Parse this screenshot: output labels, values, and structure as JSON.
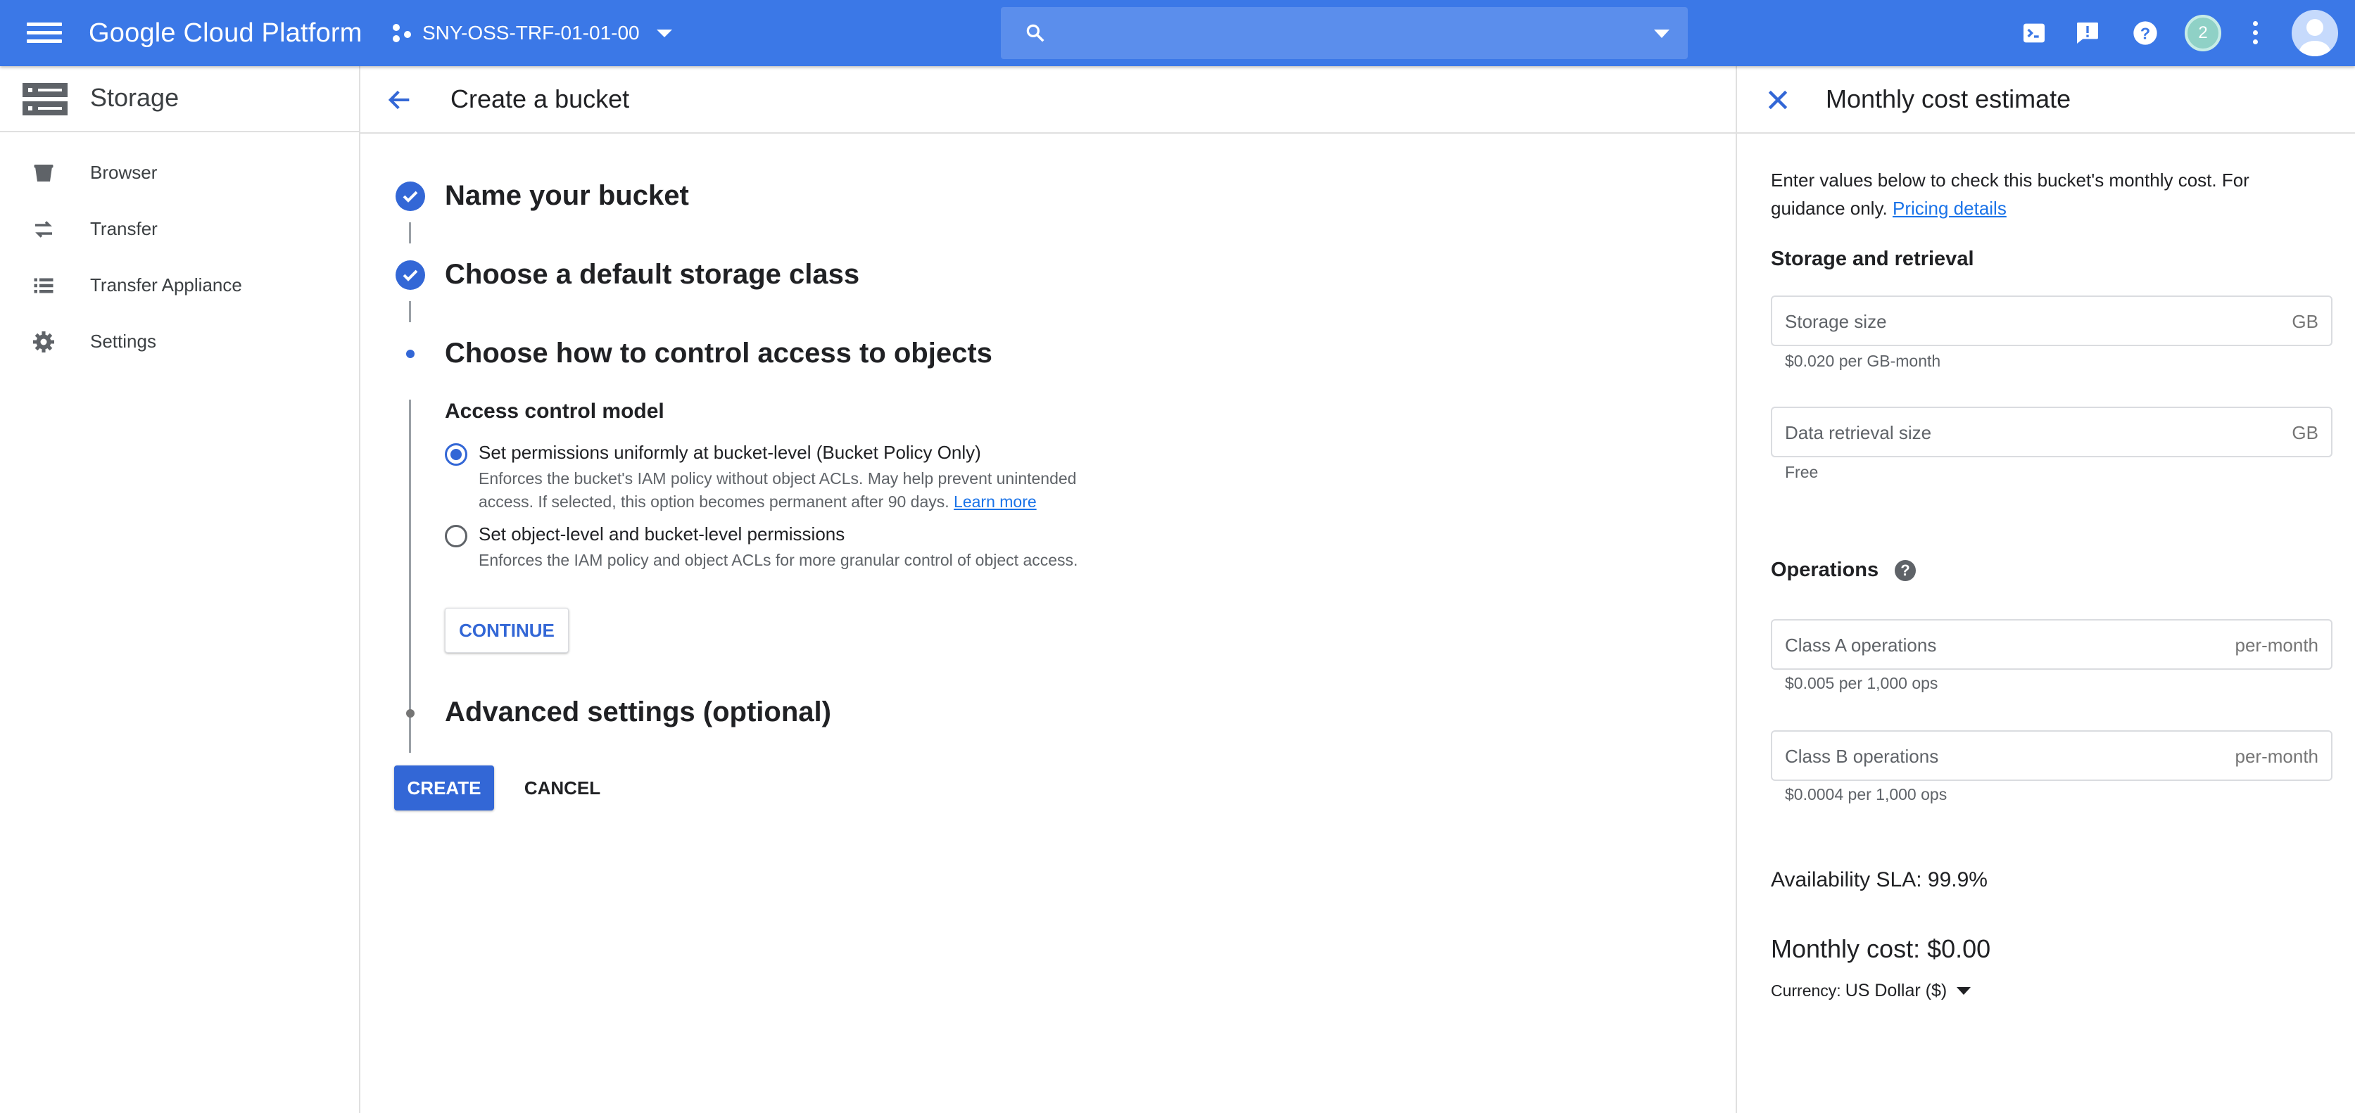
{
  "topbar": {
    "app_title": "Google Cloud Platform",
    "project": "SNY-OSS-TRF-01-01-00",
    "search_placeholder": "",
    "notification_count": "2"
  },
  "sidenav": {
    "title": "Storage",
    "items": [
      {
        "label": "Browser",
        "icon": "bucket-icon"
      },
      {
        "label": "Transfer",
        "icon": "transfer-icon"
      },
      {
        "label": "Transfer Appliance",
        "icon": "list-icon"
      },
      {
        "label": "Settings",
        "icon": "gear-icon"
      }
    ]
  },
  "main": {
    "title": "Create a bucket",
    "steps": [
      {
        "title": "Name your bucket",
        "state": "done"
      },
      {
        "title": "Choose a default storage class",
        "state": "done"
      },
      {
        "title": "Choose how to control access to objects",
        "state": "active"
      },
      {
        "title": "Advanced settings (optional)",
        "state": "pending"
      }
    ],
    "access": {
      "section_label": "Access control model",
      "options": [
        {
          "title": "Set permissions uniformly at bucket-level (Bucket Policy Only)",
          "desc_line1": "Enforces the bucket's IAM policy without object ACLs. May help prevent unintended",
          "desc_line2": "access. If selected, this option becomes permanent after 90 days.",
          "link": "Learn more",
          "selected": true
        },
        {
          "title": "Set object-level and bucket-level permissions",
          "desc_line1": "Enforces the IAM policy and object ACLs for more granular control of object access.",
          "selected": false
        }
      ],
      "continue_label": "CONTINUE"
    },
    "create_label": "CREATE",
    "cancel_label": "CANCEL"
  },
  "panel": {
    "title": "Monthly cost estimate",
    "intro": "Enter values below to check this bucket's monthly cost. For guidance only.",
    "intro_link": "Pricing details",
    "storage_section": "Storage and retrieval",
    "storage_size": {
      "placeholder": "Storage size",
      "unit": "GB",
      "hint": "$0.020 per GB-month"
    },
    "retrieval_size": {
      "placeholder": "Data retrieval size",
      "unit": "GB",
      "hint": "Free"
    },
    "operations_section": "Operations",
    "class_a": {
      "placeholder": "Class A operations",
      "unit": "per-month",
      "hint": "$0.005 per 1,000 ops"
    },
    "class_b": {
      "placeholder": "Class B operations",
      "unit": "per-month",
      "hint": "$0.0004 per 1,000 ops"
    },
    "sla": "Availability SLA: 99.9%",
    "monthly_cost": "Monthly cost: $0.00",
    "currency_label": "Currency:",
    "currency_value": "US Dollar ($)"
  },
  "colors": {
    "topbar": "#3b78e7",
    "accent": "#3367d6"
  }
}
